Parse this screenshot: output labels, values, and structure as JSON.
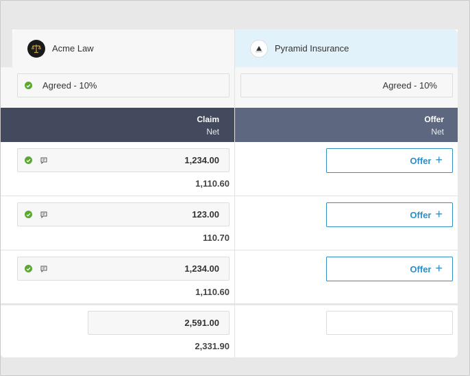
{
  "parties": {
    "left": {
      "name": "Acme Law",
      "logo_icon": "scales-of-justice-icon"
    },
    "right": {
      "name": "Pyramid Insurance",
      "logo_icon": "pyramid-icon"
    }
  },
  "agreement": {
    "left": "Agreed - 10%",
    "right": "Agreed - 10%"
  },
  "columns": {
    "left": {
      "title": "Claim",
      "sub": "Net"
    },
    "right": {
      "title": "Offer",
      "sub": "Net"
    }
  },
  "rows": [
    {
      "claim": "1,234.00",
      "net": "1,110.60",
      "offer_label": "Offer"
    },
    {
      "claim": "123.00",
      "net": "110.70",
      "offer_label": "Offer"
    },
    {
      "claim": "1,234.00",
      "net": "1,110.60",
      "offer_label": "Offer"
    }
  ],
  "total": {
    "claim": "2,591.00",
    "net": "2,331.90"
  },
  "colors": {
    "accent": "#2e8ec4",
    "check": "#5aa832",
    "header_left": "#434a5d",
    "header_right": "#5d677f",
    "party_right_bg": "#e2f2fb"
  }
}
